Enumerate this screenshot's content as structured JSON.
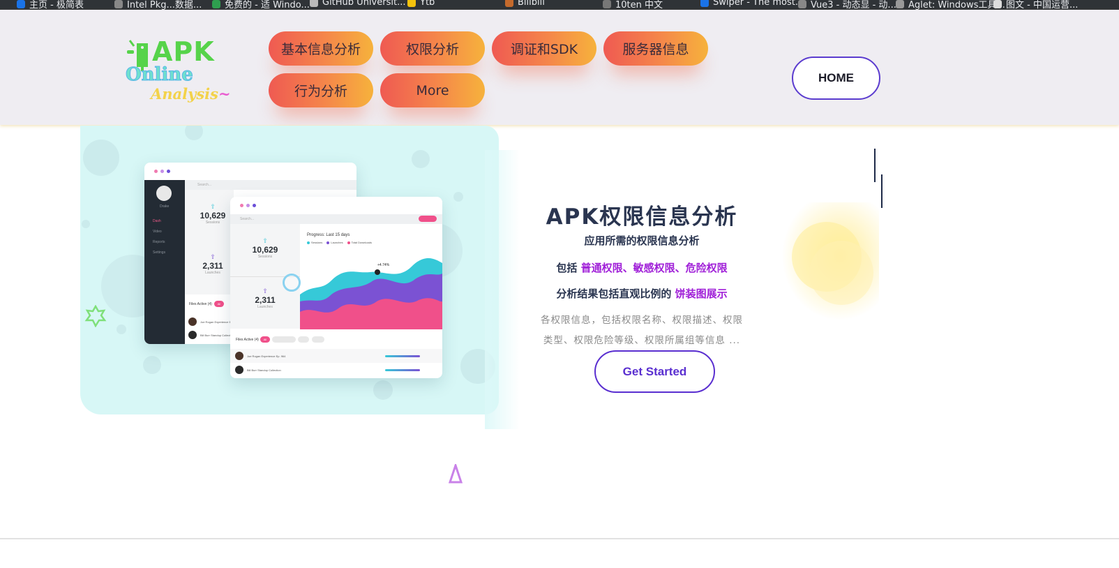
{
  "bookmarks": [
    {
      "label": "主页 - 极简表",
      "color": "#1a73e8"
    },
    {
      "label": "Intel Pkg...数据...",
      "color": "#888888"
    },
    {
      "label": "免费的 - 适 Windo...",
      "color": "#2e9e4f"
    },
    {
      "label": "GitHub Universit...",
      "color": "#bbbbbb"
    },
    {
      "label": "Ytb",
      "color": "#f4c20d"
    },
    {
      "label": "Bilibili",
      "color": "#c56a2c"
    },
    {
      "label": "10ten 中文",
      "color": "#777777"
    },
    {
      "label": "Swiper - The most...",
      "color": "#1a73e8"
    },
    {
      "label": "Vue3 - 动态显 - 动...",
      "color": "#888888"
    },
    {
      "label": "Aglet: Windows工具...",
      "color": "#999999"
    },
    {
      "label": "图文 - 中国运营...",
      "color": "#dddddd"
    }
  ],
  "logo": {
    "apk": "APK",
    "online": "Online",
    "analysis": "Analysis",
    "tilde": "~"
  },
  "nav": [
    {
      "label": "基本信息分析"
    },
    {
      "label": "权限分析"
    },
    {
      "label": "调证和SDK"
    },
    {
      "label": "服务器信息"
    },
    {
      "label": "行为分析"
    },
    {
      "label": "More"
    }
  ],
  "home_button": "HOME",
  "hero": {
    "title": "APK权限信息分析",
    "subtitle": "应用所需的权限信息分析",
    "line1_prefix": "包括",
    "line1_highlight": "普通权限、敏感权限、危险权限",
    "line2_prefix": "分析结果包括直观比例的",
    "line2_highlight": "饼装图展示",
    "desc1": "各权限信息，包括权限名称、权限描述、权限",
    "desc2": "类型、权限危险等级、权限所属组等信息 ...",
    "cta": "Get Started"
  },
  "mockup": {
    "stat1": "10,629",
    "stat1_label": "Sessions",
    "stat2": "2,311",
    "stat2_label": "Launches",
    "search": "Search...",
    "progress_title": "Progress: Last 15 days",
    "legend": [
      {
        "name": "Sessions",
        "color": "#36c9d8"
      },
      {
        "name": "Launches",
        "color": "#7b52d3"
      },
      {
        "name": "Total Downloads",
        "color": "#f0508a"
      }
    ],
    "peak_label": "+4.74%",
    "files_active": "Files Active (4)",
    "chip_all": "All",
    "row1": "Joe Rogan Experience Ep. 964",
    "row2": "Bill Burr Standup Collection",
    "sidebar_items": [
      "Dash",
      "Video",
      "Reports",
      "Settings"
    ],
    "profile_name": "Drake"
  },
  "colors": {
    "accent": "#5a2fd0",
    "highlight": "#a020d8",
    "pill_start": "#ef5a52",
    "pill_end": "#f6b23c",
    "card_bg": "#d7f7f6"
  }
}
